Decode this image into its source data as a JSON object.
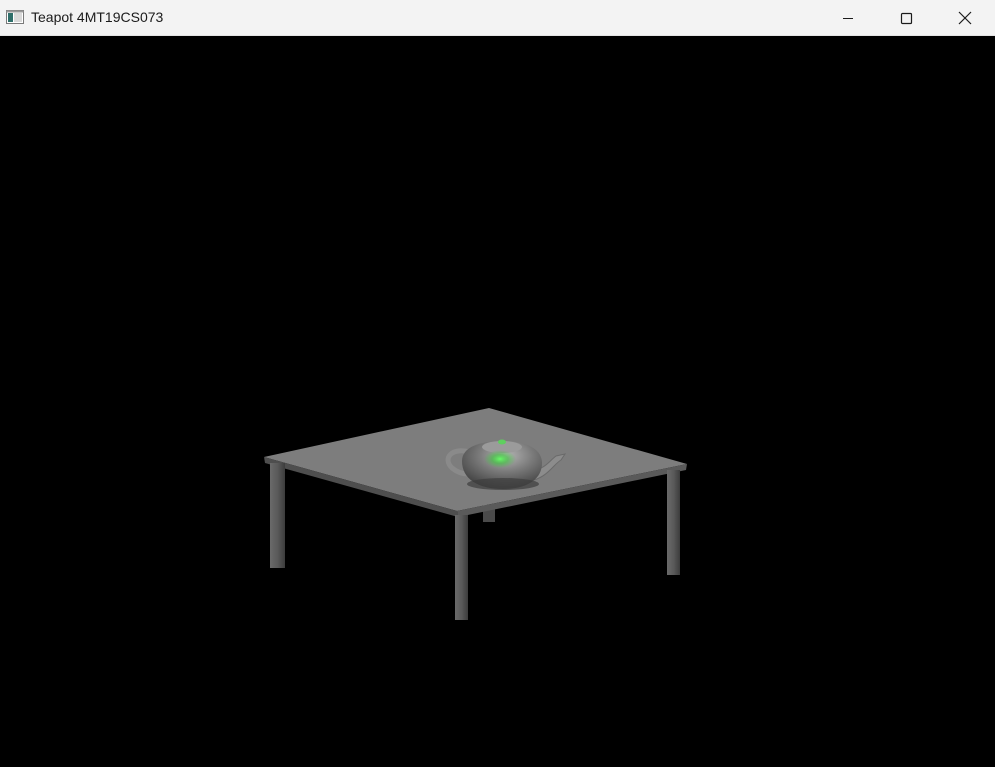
{
  "window": {
    "title": "Teapot 4MT19CS073",
    "controls": {
      "minimize_icon": "minimize-icon",
      "maximize_icon": "maximize-icon",
      "close_icon": "close-icon"
    }
  },
  "scene": {
    "background_color": "#000000",
    "objects": [
      "table",
      "teapot"
    ],
    "table_color": "#7d7d7d",
    "teapot_color": "#8a8a8a",
    "highlight_color": "#33cc33"
  }
}
